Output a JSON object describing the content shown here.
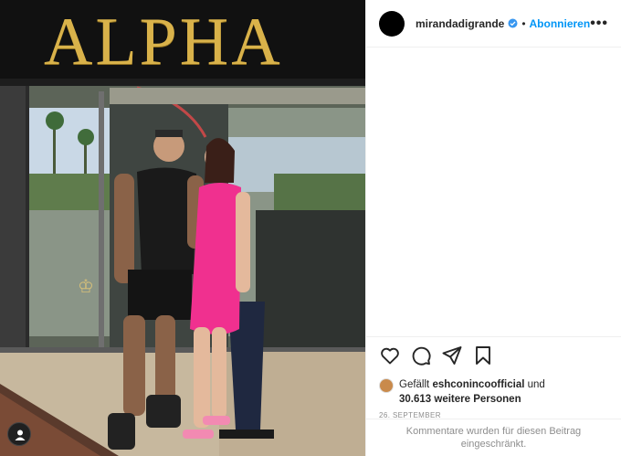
{
  "photo": {
    "alt": "",
    "sign_text": "ALPHA"
  },
  "header": {
    "username": "mirandadigrande",
    "verified": true,
    "separator": "•",
    "follow_label": "Abonnieren",
    "more_label": "•••"
  },
  "actions": {
    "like_icon": "heart-icon",
    "comment_icon": "comment-icon",
    "share_icon": "share-icon",
    "save_icon": "bookmark-icon"
  },
  "likes": {
    "prefix": "Gefällt",
    "liker": "eshconincoofficial",
    "conjunction": "und",
    "count_text": "30.613 weitere Personen"
  },
  "date": "26. SEPTEMBER",
  "comments_notice": "Kommentare wurden für diesen Beitrag eingeschränkt.",
  "colors": {
    "accent": "#0095f6",
    "text": "#262626",
    "muted": "#8e8e8e",
    "sign_gold": "#d9b24a",
    "dress_pink": "#f0308f"
  }
}
